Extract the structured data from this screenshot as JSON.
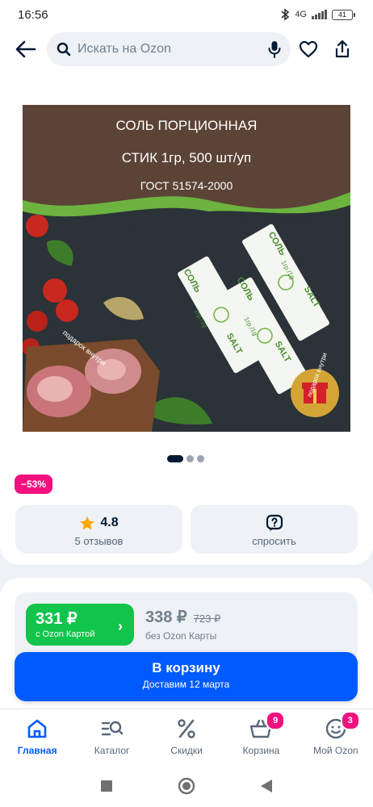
{
  "status_bar": {
    "time": "16:56",
    "network": "4G",
    "battery": "41"
  },
  "search": {
    "placeholder": "Искать на Ozon"
  },
  "product_image": {
    "title_lines": [
      "СОЛЬ ПОРЦИОННАЯ",
      "СТИК 1гр, 500 шт/уп",
      "ГОСТ 51574-2000"
    ],
    "stick_word_ru": "СОЛЬ",
    "stick_word_en": "SALT",
    "stick_weight": "1гр./1g",
    "gift_text": "подарок внутри",
    "colors": {
      "brown": "#5b4336",
      "green": "#6cb33f",
      "dark": "#2b3238"
    }
  },
  "carousel": {
    "total": 3,
    "active": 0
  },
  "discount_badge": "−53%",
  "rating_tile": {
    "value": "4.8",
    "reviews": "5 отзывов"
  },
  "ask_tile": {
    "label": "спросить"
  },
  "price": {
    "ozon_card_price": "331 ₽",
    "ozon_card_label": "с Ozon Картой",
    "regular_price": "338 ₽",
    "old_price": "723 ₽",
    "regular_label": "без Ozon Карты"
  },
  "cart_button": {
    "title": "В корзину",
    "subtitle": "Доставим 12 марта"
  },
  "bottom_nav": {
    "items": [
      {
        "label": "Главная",
        "icon": "home-icon",
        "active": true
      },
      {
        "label": "Каталог",
        "icon": "catalog-icon"
      },
      {
        "label": "Скидки",
        "icon": "percent-icon"
      },
      {
        "label": "Корзина",
        "icon": "basket-icon",
        "badge": "9"
      },
      {
        "label": "Мой Ozon",
        "icon": "profile-icon",
        "badge": "3"
      }
    ]
  },
  "accent_colors": {
    "ozon_blue": "#005bff",
    "ozon_green": "#10c44c",
    "ozon_pink": "#f1117e"
  }
}
